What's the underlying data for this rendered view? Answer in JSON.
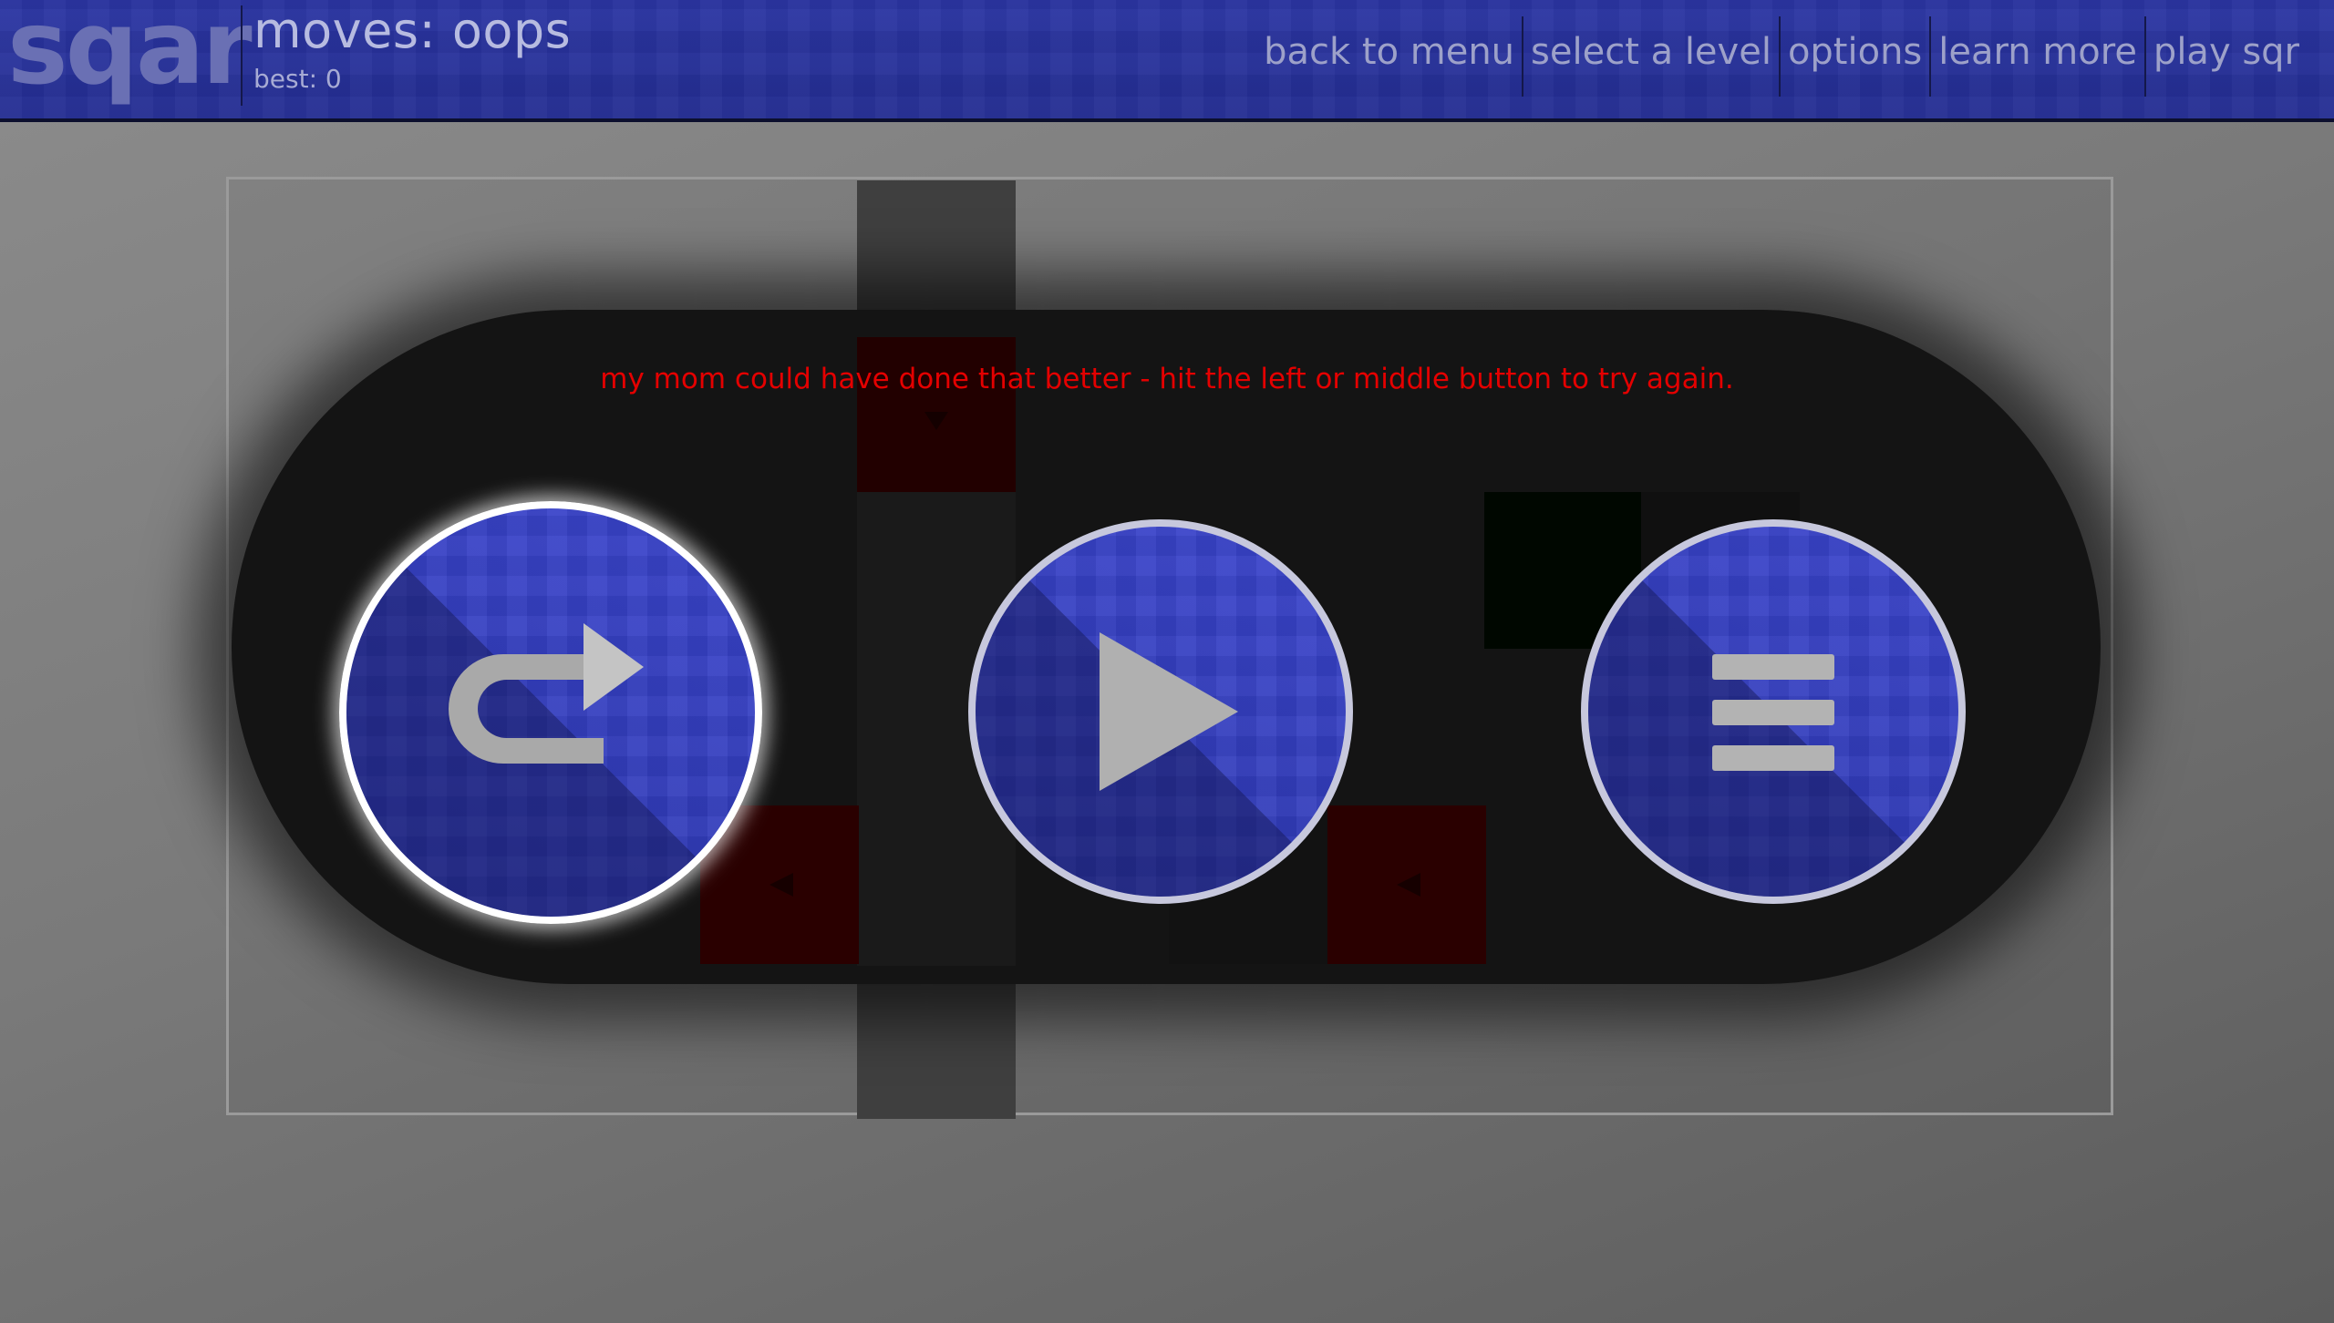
{
  "header": {
    "logo": "sqar",
    "moves_label": "moves: oops",
    "best_label": "best: 0",
    "nav": [
      {
        "label": "back to menu"
      },
      {
        "label": "select a level"
      },
      {
        "label": "options"
      },
      {
        "label": "learn more"
      },
      {
        "label": "play sqr"
      }
    ]
  },
  "modal": {
    "message": "my mom could have done that better - hit the left or middle button to try again.",
    "buttons": [
      {
        "name": "retry",
        "icon": "redo-arrow-icon",
        "active": true
      },
      {
        "name": "play",
        "icon": "play-icon",
        "active": false
      },
      {
        "name": "menu",
        "icon": "hamburger-menu-icon",
        "active": false
      }
    ]
  },
  "colors": {
    "header_blue": "#2b35a3",
    "button_blue": "#3a44cc",
    "message_red": "#e40000",
    "tile_red": "#570000"
  }
}
